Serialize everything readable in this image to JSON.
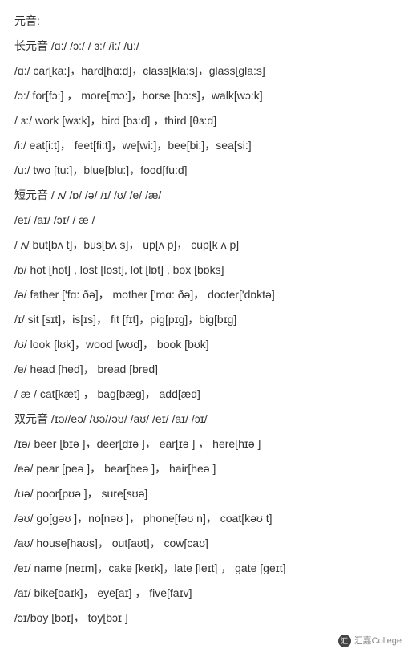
{
  "lines": [
    "元音:",
    "长元音 /ɑ:/ /ɔ:/ / ɜ:/ /i:/ /u:/",
    "/ɑ:/ car[ka:]，hard[hɑ:d]，class[kla:s]，glass[gla:s]",
    "/ɔ:/ for[fɔ:] ，  more[mɔ:]，horse [hɔ:s]，walk[wɔ:k]",
    "/ ɜ:/ work [wɜ:k]，bird [bɜ:d] ，third [θɜ:d]",
    "/i:/ eat[i:t]，  feet[fi:t]，we[wi:]，bee[bi:]，sea[si:]",
    "/u:/ two [tu:]，blue[blu:]，food[fu:d]",
    "短元音 / ʌ/ /ɒ/ /ə/ /ɪ/ /ʊ/ /e/ /æ/",
    "/eɪ/ /aɪ/ /ɔɪ/ / æ /",
    "/ ʌ/ but[bʌ t]，bus[bʌ s]，  up[ʌ p]，  cup[k ʌ p]",
    "/ɒ/ hot [hɒt] , lost [lɒst], lot [lɒt] , box [bɒks]",
    "/ə/ father ['fɑ: ðə]，  mother ['mɑ: ðə]，  docter['dɒktə]",
    "/ɪ/ sit [sɪt]，is[ɪs]，  fit [fɪt]，pig[pɪg]，big[bɪg]",
    "/ʊ/ look [lʊk]，wood [wʊd]，  book [bʊk]",
    "/e/ head [hed]，  bread [bred]",
    "/ æ / cat[kæt] ，  bag[bæg]，  add[æd]",
    "双元音 /ɪə//eə/ /ʊə//əʊ/ /aʊ/ /eɪ/ /aɪ/ /ɔɪ/",
    "/ɪə/ beer [bɪə ]，deer[dɪə ]，  ear[ɪə ] ，  here[hɪə ]",
    "/eə/ pear [peə ]，  bear[beə ]，  hair[heə ]",
    "/ʊə/ poor[pʊə ]，  sure[sʊə]",
    "/əʊ/ go[gəʊ ]，no[nəʊ ]，  phone[fəʊ n]，  coat[kəʊ t]",
    "/aʊ/ house[haʊs]，  out[aʊt]，  cow[caʊ]",
    "/eɪ/ name [neɪm]，cake [keɪk]，late [leɪt] ，  gate [geɪt]",
    "/aɪ/ bike[baɪk]，  eye[aɪ] ，  five[faɪv]",
    "/ɔɪ/boy [bɔɪ]，  toy[bɔɪ ]"
  ],
  "footer": {
    "icon_text": "汇",
    "label": "汇嘉College"
  }
}
